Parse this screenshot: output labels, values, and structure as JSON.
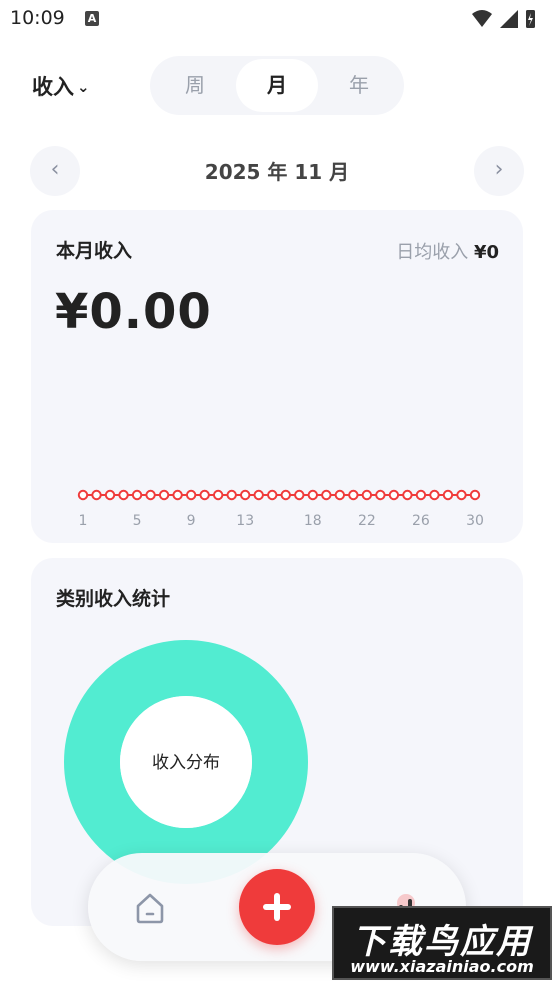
{
  "status_bar": {
    "time": "10:09",
    "notification_badge": "A"
  },
  "header": {
    "type_selector": {
      "label": "收入",
      "chevron": "⌄"
    },
    "period_tabs": [
      {
        "label": "周",
        "selected": false
      },
      {
        "label": "月",
        "selected": true
      },
      {
        "label": "年",
        "selected": false
      }
    ]
  },
  "date_nav": {
    "prev": "‹",
    "label": "2025 年 11 月",
    "next": "›"
  },
  "income_card": {
    "title": "本月收入",
    "daily_avg_label": "日均收入",
    "daily_avg_value": "¥0",
    "total": "¥0.00"
  },
  "chart_data": {
    "type": "line",
    "title": "",
    "xlabel": "",
    "ylabel": "",
    "x": [
      1,
      2,
      3,
      4,
      5,
      6,
      7,
      8,
      9,
      10,
      11,
      12,
      13,
      14,
      15,
      16,
      17,
      18,
      19,
      20,
      21,
      22,
      23,
      24,
      25,
      26,
      27,
      28,
      29,
      30
    ],
    "series": [
      {
        "values": [
          0,
          0,
          0,
          0,
          0,
          0,
          0,
          0,
          0,
          0,
          0,
          0,
          0,
          0,
          0,
          0,
          0,
          0,
          0,
          0,
          0,
          0,
          0,
          0,
          0,
          0,
          0,
          0,
          0,
          0
        ],
        "color": "#ef3b3b"
      }
    ],
    "tick_labels": [
      "1",
      "5",
      "9",
      "13",
      "18",
      "22",
      "26",
      "30"
    ],
    "tick_days": [
      1,
      5,
      9,
      13,
      18,
      22,
      26,
      30
    ],
    "grid": false
  },
  "category_card": {
    "title": "类别收入统计",
    "donut_center_label": "收入分布",
    "donut_color": "#52ecd1"
  },
  "bottom_nav": {
    "home_icon": "home-icon",
    "add_icon": "plus-icon",
    "stats_icon": "bar-chart-icon",
    "accent": "#ef3b3b"
  },
  "watermark": {
    "title": "下载鸟应用",
    "url": "www.xiazainiao.com"
  }
}
